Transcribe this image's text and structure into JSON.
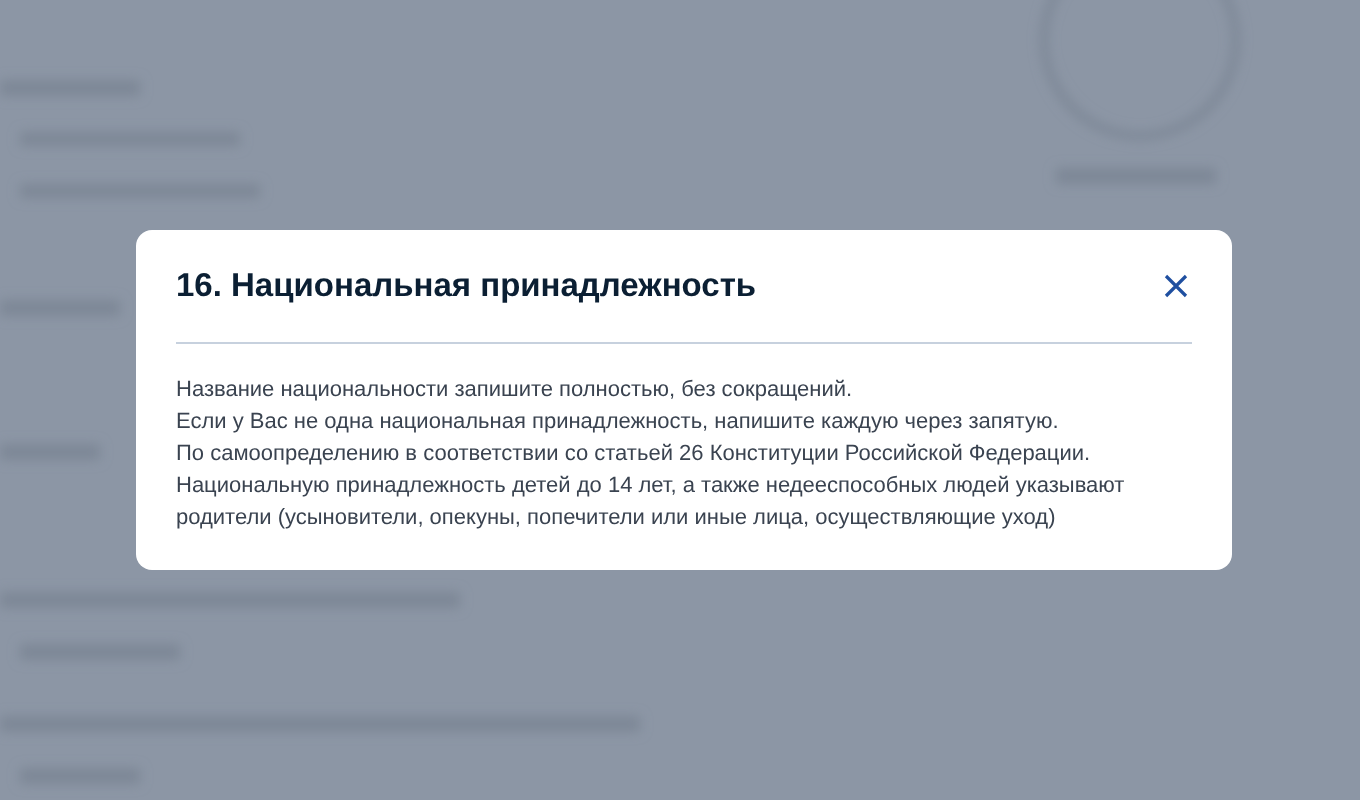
{
  "dialog": {
    "title": "16. Национальная принадлежность",
    "paragraphs": [
      "Название национальности запишите полностью, без сокращений.",
      "Если у Вас не одна национальная принадлежность, напишите каждую через запятую.",
      "По самоопределению в соответствии со статьей 26 Конституции Российской Федерации. Национальную принадлежность детей до 14 лет, а также недееспособных людей указывают родители (усыновители, опекуны, попечители или иные лица, осуществляющие уход)"
    ]
  }
}
